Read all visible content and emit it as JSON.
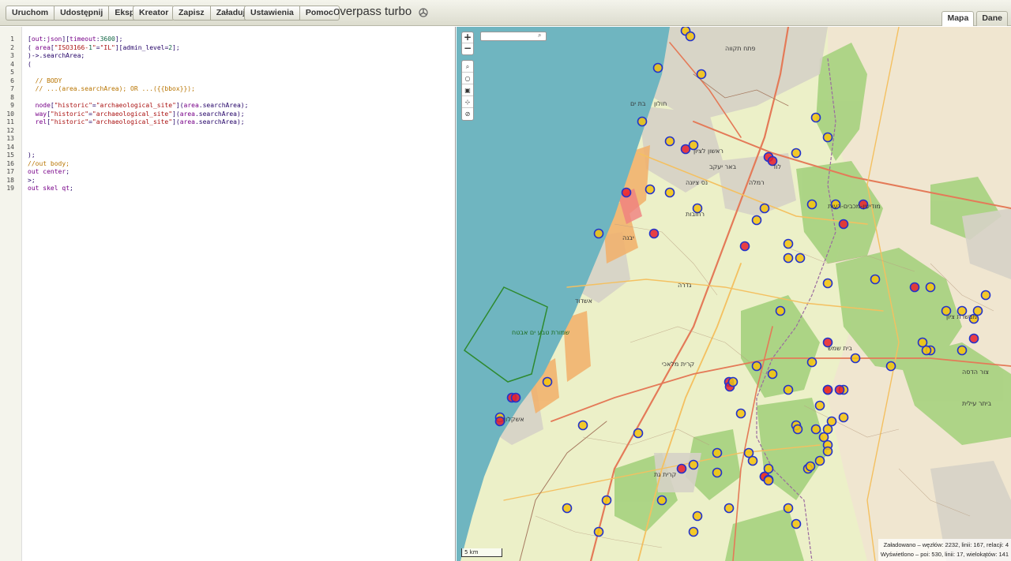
{
  "toolbar": {
    "run": "Uruchom",
    "share": "Udostępnij",
    "export": "Eksport",
    "wizard": "Kreator",
    "save": "Zapisz",
    "load": "Załaduj",
    "settings": "Ustawienia",
    "help": "Pomoc"
  },
  "app_title": "overpass turbo",
  "tabs": {
    "map": "Mapa",
    "data": "Dane"
  },
  "editor": {
    "line_numbers": [
      "1",
      "2",
      "3",
      "4",
      "5",
      "6",
      "7",
      "8",
      "9",
      "10",
      "11",
      "12",
      "13",
      "14",
      "15",
      "16",
      "17",
      "18",
      "19"
    ],
    "lines": [
      "[out:json][timeout:3600];",
      "( area[\"ISO3166-1\"=\"IL\"][admin_level=2];",
      ")->.searchArea;",
      "(",
      "",
      "  // BODY",
      "  // ...(area.searchArea); OR ...({{bbox}});",
      "",
      "  node[\"historic\"=\"archaeological_site\"](area.searchArea);",
      "  way[\"historic\"=\"archaeological_site\"](area.searchArea);",
      "  rel[\"historic\"=\"archaeological_site\"](area.searchArea);",
      "",
      "",
      "",
      ");",
      "//out body;",
      "out center;",
      ">;",
      "out skel qt;"
    ]
  },
  "map": {
    "zoom_in": "+",
    "zoom_out": "−",
    "scale": "5 km",
    "stats_loaded": "Załadowano – węzłów: 2232, linii: 167, relacji: 4",
    "stats_shown": "Wyświetlono – poi: 530, linii: 17, wielokątów: 141",
    "labels": [
      "פתח תקווה",
      "חולון",
      "ראשון לציון",
      "רחובות",
      "אשדוד",
      "אשקלון",
      "קרית גת",
      "מודיעין-מכבים-רעות",
      "רמלה",
      "לוד",
      "בת ים",
      "יבנה",
      "קרית מלאכי",
      "שמורת טבע ים אבטח",
      "בית שמש",
      "נס ציונה",
      "גדרה",
      "באר יעקב",
      "צור הדסה",
      "ביתר עילית",
      "מבשרת ציון"
    ]
  },
  "colors": {
    "sea": "#6fb5c0",
    "land": "#ecf0c8",
    "forest": "#9fcf78",
    "urban": "#d8d4cc",
    "marker_fill": "#f4c20d",
    "marker_stroke": "#2233cc",
    "marker_red": "#e8202c"
  }
}
